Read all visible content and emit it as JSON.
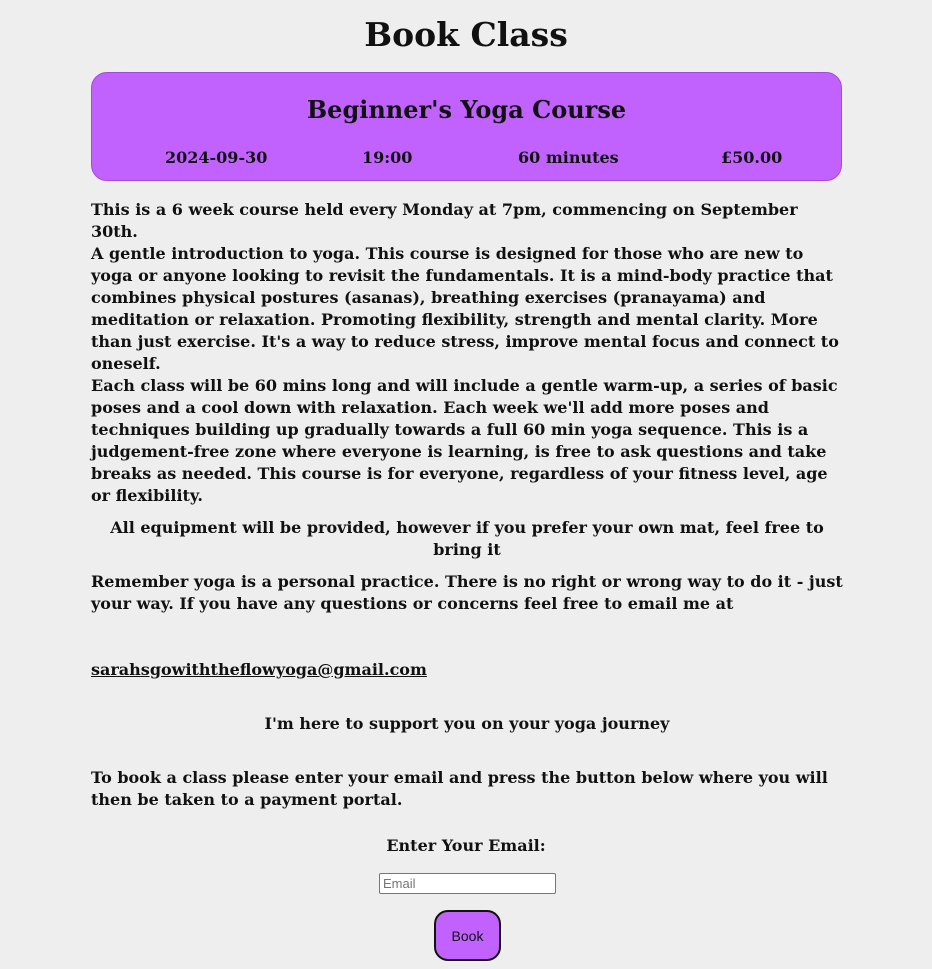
{
  "page": {
    "title": "Book Class"
  },
  "class_card": {
    "title": "Beginner's Yoga Course",
    "date": "2024-09-30",
    "time": "19:00",
    "duration": "60 minutes",
    "price": "£50.00",
    "background_color": "#c162ff"
  },
  "description": {
    "schedule": "This is a 6 week course held every Monday at 7pm, commencing on September 30th.",
    "intro": "A gentle introduction to yoga. This course is designed for those who are new to yoga or anyone looking to revisit the fundamentals. It is a mind-body practice that combines physical postures (asanas), breathing exercises (pranayama) and meditation or relaxation. Promoting flexibility, strength and mental clarity. More than just exercise. It's a way to reduce stress, improve mental focus and connect to oneself.",
    "class_details": "Each class will be 60 mins long and will include a gentle warm-up, a series of basic poses and a cool down with relaxation. Each week we'll add more poses and techniques building up gradually towards a full 60 min yoga sequence. This is a judgement-free zone where everyone is learning, is free to ask questions and take breaks as needed. This course is for everyone, regardless of your fitness level, age or flexibility.",
    "equipment": "All equipment will be provided, however if you prefer your own mat, feel free to bring it",
    "practice": "Remember yoga is a personal practice. There is no right or wrong way to do it - just your way. If you have any questions or concerns feel free to email me at",
    "contact_email": "sarahsgowiththeflowyoga@gmail.com",
    "support": "I'm here to support you on your yoga journey",
    "booking_instructions": "To book a class please enter your email and press the button below where you will then be taken to a payment portal."
  },
  "booking_form": {
    "email_label": "Enter Your Email:",
    "email_value": "",
    "email_placeholder": "Email",
    "book_button_label": "Book",
    "button_color": "#c162ff"
  }
}
